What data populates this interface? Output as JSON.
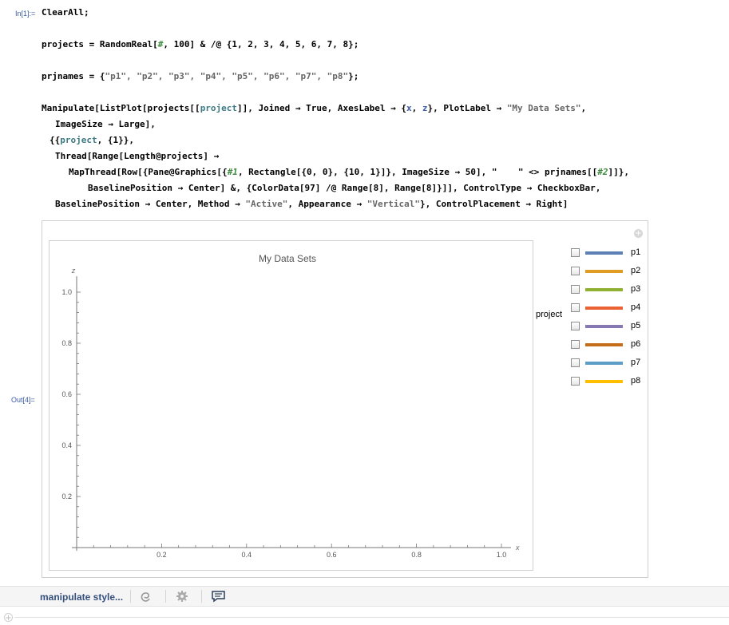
{
  "cells": {
    "in_label": "In[1]:=",
    "out_label": "Out[4]="
  },
  "code": {
    "line1": "ClearAll;",
    "line2_a": "projects = RandomReal[",
    "line2_slot": "#",
    "line2_b": ", 100] & /@ {1, 2, 3, 4, 5, 6, 7, 8};",
    "line3_a": "prjnames = {",
    "line3_strs": "\"p1\", \"p2\", \"p3\", \"p4\", \"p5\", \"p6\", \"p7\", \"p8\"",
    "line3_b": "};",
    "line4_a": "Manipulate[ListPlot[projects[[",
    "line4_var": "project",
    "line4_b": "]], Joined → True, AxesLabel → {",
    "line4_x": "x",
    "line4_c": ", ",
    "line4_z": "z",
    "line4_d": "}, PlotLabel → ",
    "line4_str": "\"My Data Sets\"",
    "line4_e": ",",
    "line5": "ImageSize → Large],",
    "line6_a": "{{",
    "line6_var": "project",
    "line6_b": ", {1}},",
    "line7": "Thread[Range[Length@projects] →",
    "line8_a": "MapThread[Row[{Pane@Graphics[{",
    "line8_slot1": "#1",
    "line8_b": ", Rectangle[{0, 0}, {10, 1}]}, ImageSize → 50], \"    \" <> prjnames[[",
    "line8_slot2": "#2",
    "line8_c": "]]},",
    "line9": "BaselinePosition → Center] &, {ColorData[97] /@ Range[8], Range[8]}]], ControlType → CheckboxBar,",
    "line10_a": "BaselinePosition → Center, Method → ",
    "line10_s1": "\"Active\"",
    "line10_b": ", Appearance → ",
    "line10_s2": "\"Vertical\"",
    "line10_c": "}, ControlPlacement → Right]"
  },
  "manipulate": {
    "control_label": "project",
    "add_icon": "plus-circle-icon",
    "checkboxes": [
      {
        "name": "p1",
        "color": "#5e81b5",
        "checked": false
      },
      {
        "name": "p2",
        "color": "#e19c24",
        "checked": false
      },
      {
        "name": "p3",
        "color": "#8fb032",
        "checked": false
      },
      {
        "name": "p4",
        "color": "#eb6235",
        "checked": false
      },
      {
        "name": "p5",
        "color": "#8778b3",
        "checked": false
      },
      {
        "name": "p6",
        "color": "#c56e1a",
        "checked": false
      },
      {
        "name": "p7",
        "color": "#5d9ec7",
        "checked": false
      },
      {
        "name": "p8",
        "color": "#ffbf00",
        "checked": false
      }
    ]
  },
  "chart_data": {
    "type": "line",
    "title": "My Data Sets",
    "xlabel": "x",
    "ylabel": "z",
    "xlim": [
      0,
      1.0
    ],
    "ylim": [
      0,
      1.0
    ],
    "xticks": [
      "0.2",
      "0.4",
      "0.6",
      "0.8",
      "1.0"
    ],
    "yticks": [
      "0.2",
      "0.4",
      "0.6",
      "0.8",
      "1.0"
    ],
    "series": []
  },
  "toolbar": {
    "suggestion_label": "manipulate style...",
    "icons": [
      "undo-spiral-icon",
      "gear-icon",
      "comment-icon"
    ]
  }
}
